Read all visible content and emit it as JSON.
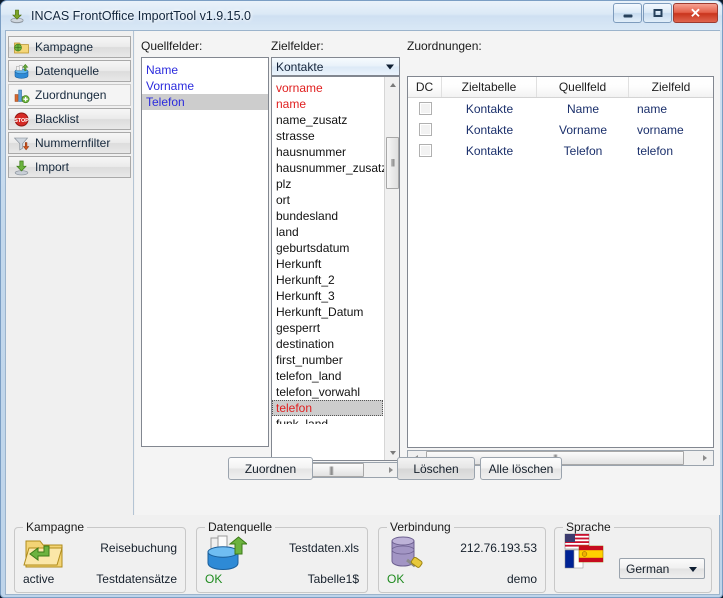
{
  "window": {
    "title": "INCAS FrontOffice ImportTool v1.9.15.0",
    "title_icon": "import-tool-icon",
    "minimize_label": "–",
    "maximize_label": "□",
    "close_label": "✕"
  },
  "sidebar": {
    "items": [
      {
        "label": "Kampagne",
        "icon": "folder-globe-icon",
        "selected": false
      },
      {
        "label": "Datenquelle",
        "icon": "data-import-icon",
        "selected": false
      },
      {
        "label": "Zuordnungen",
        "icon": "chart-add-icon",
        "selected": true
      },
      {
        "label": "Blacklist",
        "icon": "stop-sign-icon",
        "selected": false
      },
      {
        "label": "Nummernfilter",
        "icon": "funnel-down-icon",
        "selected": false
      },
      {
        "label": "Import",
        "icon": "download-arrow-icon",
        "selected": false
      }
    ]
  },
  "main": {
    "source_fields": {
      "label": "Quellfelder:",
      "items": [
        {
          "text": "Name",
          "selected": false
        },
        {
          "text": "Vorname",
          "selected": false
        },
        {
          "text": "Telefon",
          "selected": true
        }
      ]
    },
    "target_fields": {
      "label": "Zielfelder:",
      "table_selected": "Kontakte",
      "items": [
        {
          "text": "vorname",
          "color": "red",
          "selected": false
        },
        {
          "text": "name",
          "color": "red",
          "selected": false
        },
        {
          "text": "name_zusatz",
          "color": "black",
          "selected": false
        },
        {
          "text": "strasse",
          "color": "black",
          "selected": false
        },
        {
          "text": "hausnummer",
          "color": "black",
          "selected": false
        },
        {
          "text": "hausnummer_zusatz",
          "color": "black",
          "selected": false
        },
        {
          "text": "plz",
          "color": "black",
          "selected": false
        },
        {
          "text": "ort",
          "color": "black",
          "selected": false
        },
        {
          "text": "bundesland",
          "color": "black",
          "selected": false
        },
        {
          "text": "land",
          "color": "black",
          "selected": false
        },
        {
          "text": "geburtsdatum",
          "color": "black",
          "selected": false
        },
        {
          "text": "Herkunft",
          "color": "black",
          "selected": false
        },
        {
          "text": "Herkunft_2",
          "color": "black",
          "selected": false
        },
        {
          "text": "Herkunft_3",
          "color": "black",
          "selected": false
        },
        {
          "text": "Herkunft_Datum",
          "color": "black",
          "selected": false
        },
        {
          "text": "gesperrt",
          "color": "black",
          "selected": false
        },
        {
          "text": "destination",
          "color": "black",
          "selected": false
        },
        {
          "text": "first_number",
          "color": "black",
          "selected": false
        },
        {
          "text": "telefon_land",
          "color": "black",
          "selected": false
        },
        {
          "text": "telefon_vorwahl",
          "color": "black",
          "selected": false
        },
        {
          "text": "telefon",
          "color": "red",
          "selected": true
        },
        {
          "text": "funk_land",
          "color": "black",
          "selected": false
        }
      ]
    },
    "mappings": {
      "label": "Zuordnungen:",
      "columns": [
        "DC",
        "Zieltabelle",
        "Quellfeld",
        "Zielfeld"
      ],
      "rows": [
        {
          "dc": false,
          "zieltabelle": "Kontakte",
          "quellfeld": "Name",
          "zielfeld": "name"
        },
        {
          "dc": false,
          "zieltabelle": "Kontakte",
          "quellfeld": "Vorname",
          "zielfeld": "vorname"
        },
        {
          "dc": false,
          "zieltabelle": "Kontakte",
          "quellfeld": "Telefon",
          "zielfeld": "telefon"
        }
      ]
    },
    "buttons": {
      "assign": "Zuordnen",
      "delete": "Löschen",
      "delete_all": "Alle löschen"
    }
  },
  "status": {
    "kampagne": {
      "caption": "Kampagne",
      "icon": "folder-arrow-icon",
      "name": "Reisebuchung",
      "state": "active",
      "detail": "Testdatensätze"
    },
    "datenquelle": {
      "caption": "Datenquelle",
      "icon": "data-import-icon",
      "file": "Testdaten.xls",
      "state": "OK",
      "detail": "Tabelle1$"
    },
    "verbindung": {
      "caption": "Verbindung",
      "icon": "database-plug-icon",
      "host": "212.76.193.53",
      "state": "OK",
      "detail": "demo"
    },
    "sprache": {
      "caption": "Sprache",
      "icon": "flags-icon",
      "selected": "German"
    }
  },
  "colors": {
    "source_text": "#2b2bdd",
    "target_required": "#e02020",
    "target_normal": "#111111",
    "table_text": "#1a2f6b",
    "ok_green": "#1f8b1f",
    "selection_gray": "#cdcdcd",
    "window_chrome": "#cfe0f2",
    "close_red": "#c9341c"
  }
}
